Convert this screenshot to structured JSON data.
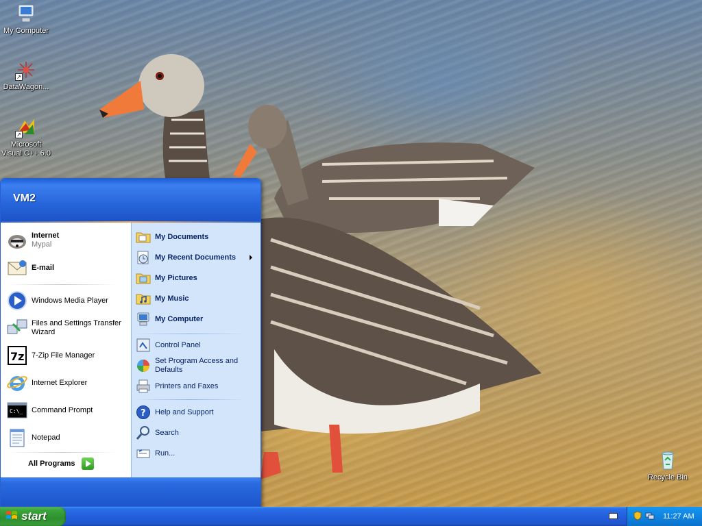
{
  "desktop": {
    "icons": [
      {
        "label": "My Computer",
        "icon": "my-computer-icon"
      },
      {
        "label": "DataWagon...",
        "icon": "datawagon-icon"
      },
      {
        "label": "Microsoft Visual C++ 6.0",
        "icon": "visual-cpp-icon"
      },
      {
        "label": "Recycle Bin",
        "icon": "recycle-bin-icon"
      }
    ]
  },
  "start_menu": {
    "user": "VM2",
    "pinned": [
      {
        "label": "Internet",
        "sublabel": "Mypal",
        "icon": "mypal-icon"
      },
      {
        "label": "E-mail",
        "icon": "email-icon"
      }
    ],
    "recent": [
      {
        "label": "Windows Media Player",
        "icon": "media-player-icon"
      },
      {
        "label": "Files and Settings Transfer Wizard",
        "icon": "transfer-wizard-icon"
      },
      {
        "label": "7-Zip File Manager",
        "icon": "7zip-icon"
      },
      {
        "label": "Internet Explorer",
        "icon": "internet-explorer-icon"
      },
      {
        "label": "Command Prompt",
        "icon": "command-prompt-icon"
      },
      {
        "label": "Notepad",
        "icon": "notepad-icon"
      }
    ],
    "all_programs": "All Programs",
    "places": [
      {
        "label": "My Documents",
        "icon": "folder-icon"
      },
      {
        "label": "My Recent Documents",
        "icon": "recent-documents-icon"
      },
      {
        "label": "My Pictures",
        "icon": "folder-icon"
      },
      {
        "label": "My Music",
        "icon": "folder-icon"
      },
      {
        "label": "My Computer",
        "icon": "my-computer-icon"
      }
    ],
    "settings": [
      {
        "label": "Control Panel",
        "icon": "control-panel-icon"
      },
      {
        "label": "Set Program Access and Defaults",
        "icon": "program-access-icon"
      },
      {
        "label": "Printers and Faxes",
        "icon": "printer-icon"
      }
    ],
    "help": [
      {
        "label": "Help and Support",
        "icon": "help-icon"
      },
      {
        "label": "Search",
        "icon": "search-icon"
      },
      {
        "label": "Run...",
        "icon": "run-icon"
      }
    ]
  },
  "taskbar": {
    "start_label": "start",
    "clock": "11:27 AM"
  }
}
